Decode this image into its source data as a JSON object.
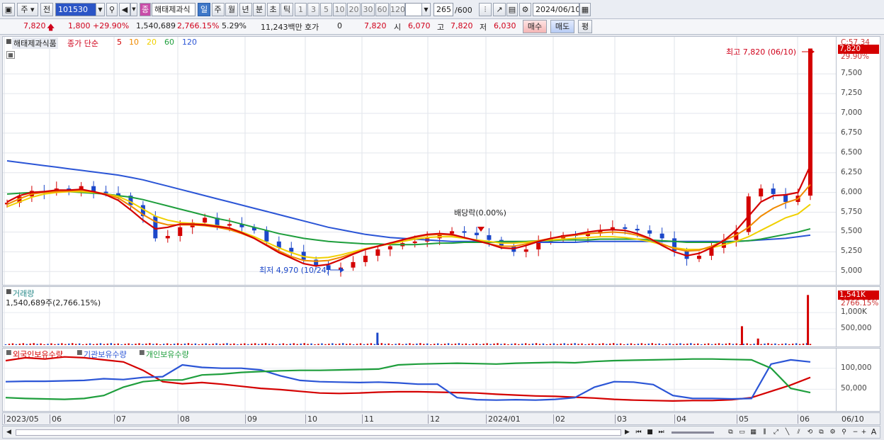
{
  "toolbar": {
    "period_unit": "주",
    "prev_label": "전",
    "stock_code": "101530",
    "stock_name": "해태제과식",
    "period_tabs": [
      "일",
      "주",
      "월",
      "년",
      "분",
      "초",
      "틱"
    ],
    "active_period": "일",
    "intervals": [
      "1",
      "3",
      "5",
      "10",
      "20",
      "30",
      "60",
      "120"
    ],
    "count": "265",
    "count_max": "/600",
    "date": "2024/06/10",
    "name_badge": "종"
  },
  "quote": {
    "price": "7,820",
    "change": "1,800",
    "change_pct": "+29.90%",
    "volume": "1,540,689",
    "volume_ratio": "2,766.15%",
    "turnover_pct": "5.29%",
    "amount": "11,243백만",
    "hoga_label": "호가",
    "hoga_value": "0",
    "hoga_price": "7,820",
    "open_label": "시",
    "open": "6,070",
    "high_label": "고",
    "high": "7,820",
    "low_label": "저",
    "low": "6,030",
    "buy_label": "매수",
    "sell_label": "매도",
    "avg_label": "평"
  },
  "price_panel": {
    "title": "해태제과식품",
    "ma_label": "종가 단순",
    "ma_periods": [
      "5",
      "10",
      "20",
      "60",
      "120"
    ],
    "ma_colors": [
      "#d40000",
      "#f08a00",
      "#f0d000",
      "#1e9e3c",
      "#2b55d6"
    ],
    "y_top_label": "C:57.34",
    "price_tag": "7,820",
    "pct_tag": "29.90%",
    "high_annotation": "최고 7,820 (06/10)",
    "low_annotation": "최저 4,970 (10/24)",
    "dividend_annotation": "배당락(0.00%)"
  },
  "volume_panel": {
    "title": "거래량",
    "value_text": "1,540,689주(2,766.15%)",
    "tag_value": "1,541K",
    "tag_pct": "2766.15%"
  },
  "holdings_panel": {
    "series": [
      {
        "name": "외국인보유수량",
        "color": "#d40000"
      },
      {
        "name": "기관보유수량",
        "color": "#2b55d6"
      },
      {
        "name": "개인보유수량",
        "color": "#1e9e3c"
      }
    ]
  },
  "x_axis": {
    "labels": [
      "2023/05",
      "06",
      "07",
      "08",
      "09",
      "10",
      "11",
      "12",
      "2024/01",
      "02",
      "03",
      "04",
      "05",
      "06"
    ],
    "right_label": "06/10"
  },
  "chart_data": [
    {
      "type": "candlestick",
      "title": "해태제과식품",
      "y_ticks": [
        "7,500",
        "7,250",
        "7,000",
        "6,750",
        "6,500",
        "6,250",
        "6,000",
        "5,750",
        "5,500",
        "5,250",
        "5,000"
      ],
      "ylim": [
        4850,
        7950
      ],
      "close": [
        5870,
        5950,
        6020,
        6000,
        6050,
        6020,
        6080,
        6010,
        5990,
        5960,
        5840,
        5700,
        5420,
        5450,
        5560,
        5620,
        5680,
        5580,
        5600,
        5560,
        5520,
        5380,
        5300,
        5250,
        5150,
        5080,
        5020,
        5050,
        5120,
        5200,
        5280,
        5320,
        5360,
        5380,
        5420,
        5480,
        5510,
        5490,
        5460,
        5400,
        5320,
        5250,
        5280,
        5380,
        5420,
        5460,
        5450,
        5480,
        5520,
        5560,
        5540,
        5520,
        5480,
        5420,
        5260,
        5160,
        5200,
        5300,
        5400,
        5500,
        5950,
        6050,
        5980,
        5880,
        5960,
        7820
      ],
      "ma": {
        "5": [
          5880,
          5960,
          6000,
          6010,
          6030,
          6030,
          6040,
          6010,
          5970,
          5900,
          5780,
          5650,
          5540,
          5560,
          5600,
          5600,
          5590,
          5570,
          5550,
          5490,
          5420,
          5330,
          5240,
          5170,
          5100,
          5070,
          5090,
          5150,
          5220,
          5280,
          5320,
          5360,
          5400,
          5440,
          5470,
          5480,
          5470,
          5430,
          5390,
          5350,
          5300,
          5290,
          5330,
          5380,
          5420,
          5450,
          5470,
          5500,
          5520,
          5530,
          5520,
          5480,
          5420,
          5330,
          5250,
          5200,
          5230,
          5300,
          5390,
          5520,
          5700,
          5880,
          5960,
          5970,
          6000,
          6340
        ],
        "10": [
          5850,
          5920,
          5980,
          6000,
          6010,
          6020,
          6030,
          6010,
          5980,
          5930,
          5830,
          5720,
          5630,
          5590,
          5590,
          5590,
          5580,
          5560,
          5530,
          5480,
          5420,
          5340,
          5260,
          5190,
          5140,
          5130,
          5140,
          5180,
          5230,
          5280,
          5320,
          5360,
          5400,
          5430,
          5460,
          5470,
          5460,
          5430,
          5390,
          5350,
          5320,
          5320,
          5350,
          5390,
          5420,
          5440,
          5460,
          5480,
          5490,
          5500,
          5490,
          5460,
          5410,
          5350,
          5290,
          5260,
          5270,
          5320,
          5390,
          5460,
          5560,
          5700,
          5800,
          5870,
          5920,
          6100
        ],
        "20": [
          5820,
          5880,
          5940,
          5980,
          6000,
          6010,
          6010,
          6000,
          5980,
          5950,
          5880,
          5790,
          5700,
          5650,
          5620,
          5610,
          5600,
          5580,
          5550,
          5500,
          5440,
          5370,
          5300,
          5240,
          5190,
          5170,
          5180,
          5210,
          5250,
          5290,
          5320,
          5350,
          5380,
          5410,
          5430,
          5440,
          5440,
          5420,
          5400,
          5380,
          5360,
          5360,
          5370,
          5390,
          5400,
          5410,
          5420,
          5430,
          5440,
          5440,
          5430,
          5410,
          5380,
          5340,
          5300,
          5280,
          5280,
          5300,
          5340,
          5380,
          5440,
          5520,
          5600,
          5680,
          5730,
          5850
        ],
        "60": [
          5980,
          5990,
          6000,
          6010,
          6010,
          6010,
          6000,
          5990,
          5980,
          5960,
          5940,
          5910,
          5870,
          5830,
          5790,
          5750,
          5710,
          5670,
          5640,
          5600,
          5560,
          5520,
          5480,
          5450,
          5420,
          5400,
          5380,
          5370,
          5360,
          5350,
          5350,
          5340,
          5340,
          5340,
          5350,
          5360,
          5360,
          5370,
          5370,
          5370,
          5380,
          5380,
          5380,
          5390,
          5390,
          5400,
          5400,
          5400,
          5410,
          5410,
          5410,
          5410,
          5400,
          5390,
          5380,
          5370,
          5370,
          5370,
          5370,
          5380,
          5390,
          5410,
          5440,
          5470,
          5500,
          5540
        ],
        "120": [
          6400,
          6380,
          6360,
          6340,
          6320,
          6300,
          6280,
          6260,
          6240,
          6220,
          6190,
          6160,
          6120,
          6080,
          6040,
          6000,
          5960,
          5920,
          5880,
          5840,
          5800,
          5760,
          5720,
          5680,
          5640,
          5600,
          5560,
          5530,
          5500,
          5470,
          5450,
          5430,
          5420,
          5410,
          5400,
          5390,
          5380,
          5380,
          5380,
          5370,
          5370,
          5370,
          5370,
          5370,
          5370,
          5370,
          5370,
          5380,
          5380,
          5380,
          5380,
          5380,
          5380,
          5380,
          5380,
          5380,
          5380,
          5380,
          5380,
          5380,
          5390,
          5400,
          5410,
          5420,
          5440,
          5460
        ]
      }
    },
    {
      "type": "bar",
      "title": "거래량",
      "y_ticks": [
        "1,000K",
        "500,000"
      ],
      "ylim": [
        0,
        1700000
      ],
      "spikes": [
        {
          "at": 0.462,
          "value": 380000
        },
        {
          "at": 0.915,
          "value": 580000
        },
        {
          "at": 0.935,
          "value": 200000
        },
        {
          "at": 0.997,
          "value": 1540689
        }
      ],
      "base": 40000
    },
    {
      "type": "line",
      "title": "보유수량",
      "y_ticks": [
        "100,000",
        "50,000"
      ],
      "ylim": [
        5000,
        140000
      ],
      "series": [
        {
          "name": "외국인보유수량",
          "values": [
            118000,
            125000,
            122000,
            127000,
            125000,
            120000,
            115000,
            95000,
            68000,
            63000,
            66000,
            62000,
            57000,
            52000,
            49000,
            45000,
            41000,
            40000,
            41000,
            43000,
            44000,
            44000,
            43000,
            42000,
            41000,
            38000,
            36000,
            34000,
            33000,
            31000,
            29000,
            26000,
            24000,
            23000,
            22000,
            23000,
            23000,
            25000,
            30000,
            45000,
            60000,
            78000
          ]
        },
        {
          "name": "기관보유수량",
          "values": [
            68000,
            69000,
            69000,
            70000,
            71000,
            75000,
            73000,
            78000,
            80000,
            108000,
            102000,
            100000,
            100000,
            96000,
            82000,
            71000,
            68000,
            67000,
            66000,
            67000,
            65000,
            62000,
            62000,
            30000,
            25000,
            24000,
            25000,
            24000,
            26000,
            30000,
            55000,
            68000,
            67000,
            61000,
            35000,
            28000,
            28000,
            27000,
            28000,
            110000,
            120000,
            115000
          ]
        },
        {
          "name": "개인보유수량",
          "values": [
            30000,
            28000,
            27000,
            26000,
            28000,
            35000,
            55000,
            68000,
            72000,
            72000,
            84000,
            86000,
            90000,
            92000,
            94000,
            95000,
            95000,
            96000,
            97000,
            98000,
            108000,
            110000,
            111000,
            112000,
            111000,
            110000,
            112000,
            113000,
            114000,
            113000,
            116000,
            118000,
            119000,
            120000,
            121000,
            122000,
            122000,
            121000,
            120000,
            100000,
            52000,
            42000
          ]
        }
      ]
    }
  ]
}
